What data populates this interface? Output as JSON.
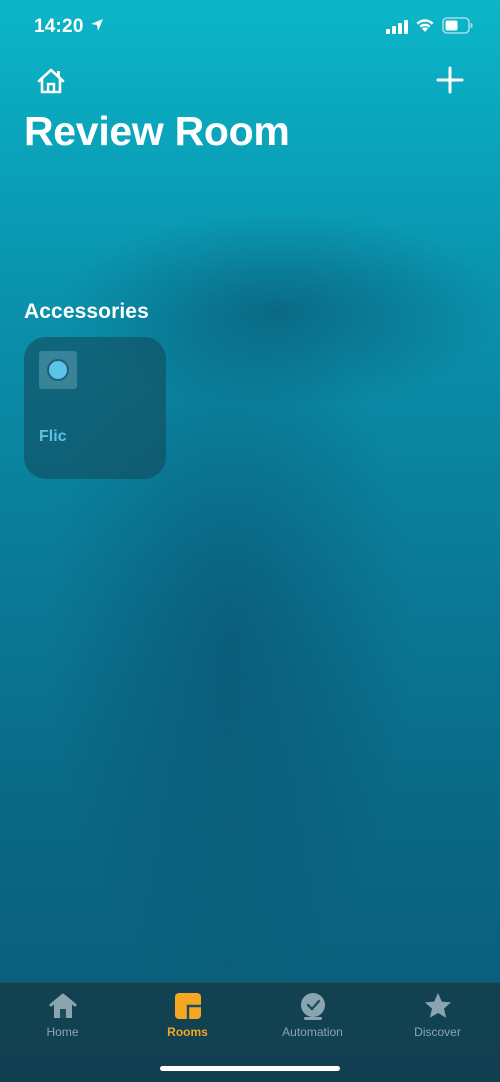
{
  "status_bar": {
    "time": "14:20"
  },
  "header": {
    "title": "Review Room"
  },
  "section": {
    "title": "Accessories"
  },
  "accessories": [
    {
      "name": "Flic"
    }
  ],
  "tabs": [
    {
      "label": "Home",
      "icon": "house-icon"
    },
    {
      "label": "Rooms",
      "icon": "rooms-icon",
      "active": true
    },
    {
      "label": "Automation",
      "icon": "automation-clock-icon"
    },
    {
      "label": "Discover",
      "icon": "star-icon"
    }
  ],
  "colors": {
    "accent": "#f5a623",
    "tile_label": "#5cc4e6",
    "tab_inactive": "#8aa5b0"
  }
}
